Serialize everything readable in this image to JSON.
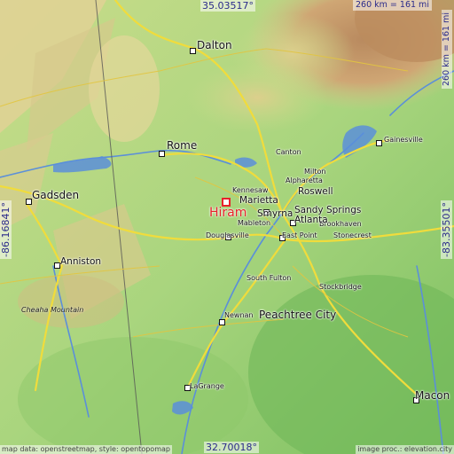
{
  "map": {
    "highlight_place": "Hiram",
    "coords": {
      "top": "35.03517°",
      "bottom": "32.70018°",
      "left": "-86.16841°",
      "right": "-83.35501°"
    },
    "scale_top": "260 km = 161 mi",
    "scale_right": "260 km = 161 mi",
    "attribution_left": "map data: openstreetmap, style: opentopomap",
    "attribution_right": "image proc.: elevation.city",
    "mountain_label": "Cheaha Mountain",
    "cities": {
      "dalton": "Dalton",
      "rome": "Rome",
      "canton": "Canton",
      "gainesville": "Gainesville",
      "milton": "Milton",
      "alpharetta": "Alpharetta",
      "roswell": "Roswell",
      "kennesaw": "Kennesaw",
      "marietta": "Marietta",
      "sandy_springs": "Sandy Springs",
      "smyrna": "Smyrna",
      "brookhaven": "Brookhaven",
      "mableton": "Mableton",
      "atlanta": "Atlanta",
      "douglasville": "Douglasville",
      "east_point": "East Point",
      "stonecrest": "Stonecrest",
      "south_fulton": "South Fulton",
      "stockbridge": "Stockbridge",
      "peachtree_city": "Peachtree City",
      "newnan": "Newnan",
      "lagrange": "LaGrange",
      "macon": "Macon",
      "gadsden": "Gadsden",
      "anniston": "Anniston"
    },
    "colors": {
      "lowland": "#a6d57f",
      "upland": "#d9cf92",
      "ridge": "#c79c6e",
      "water": "#5b8fd9",
      "road": "#f0dc3c",
      "highlight": "#e8222a"
    }
  }
}
